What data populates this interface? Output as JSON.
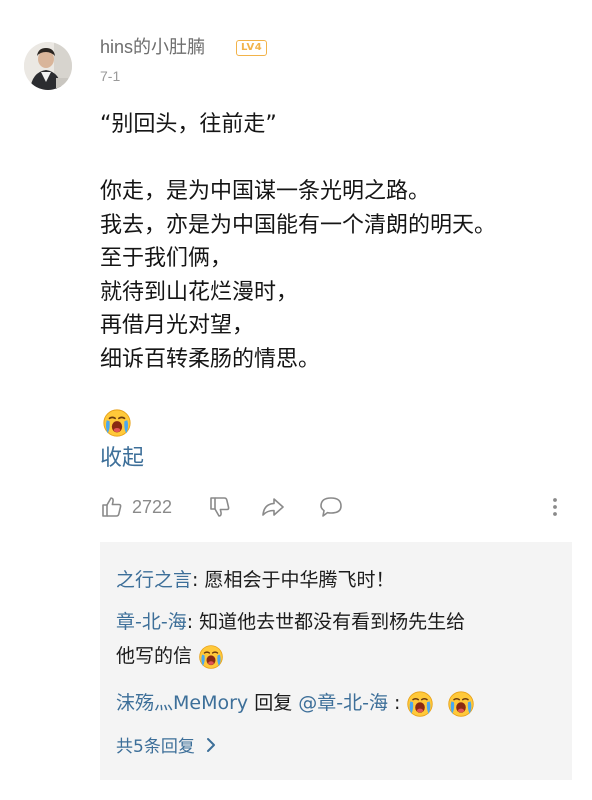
{
  "comment": {
    "username": "hins的小肚腩",
    "level_badge": "LV4",
    "date": "7-1",
    "body_lines": [
      "“别回头，往前走”",
      "",
      "你走，是为中国谋一条光明之路。",
      "我去，亦是为中国能有一个清朗的明天。",
      "至于我们俩，",
      "就待到山花烂漫时，",
      "再借月光对望，",
      "细诉百转柔肠的情思。"
    ],
    "body_emoji": "crying-face-emoji",
    "collapse_label": "收起"
  },
  "actions": {
    "like_count": "2722",
    "icons": [
      "thumbs-up-icon",
      "thumbs-down-icon",
      "share-icon",
      "comment-icon",
      "more-icon"
    ]
  },
  "replies": {
    "items": [
      {
        "name": "之行之言",
        "sep": ": ",
        "text": "愿相会于中华腾飞时！"
      },
      {
        "name": "章-北-海",
        "sep": ": ",
        "text": "知道他去世都没有看到杨先生给",
        "text2": "他写的信"
      },
      {
        "name": "沫殇灬MeMory",
        "reply_word": " 回复 ",
        "target": "@章-北-海",
        "sep": " : "
      }
    ],
    "more_label": "共5条回复"
  },
  "colors": {
    "link_blue": "#3d6f99",
    "badge_orange": "#f2b34a",
    "reply_bg": "#f4f4f4",
    "meta_gray": "#9a9a9a"
  }
}
